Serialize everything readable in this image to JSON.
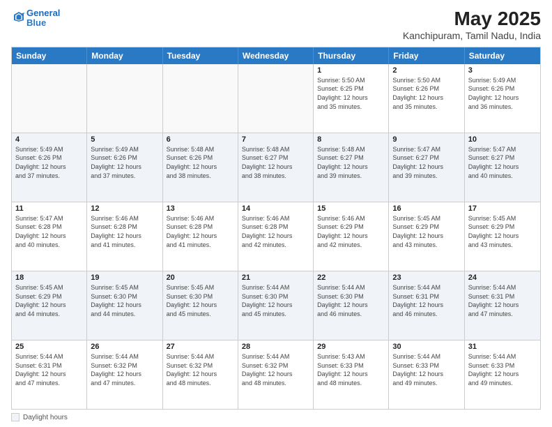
{
  "header": {
    "logo_line1": "General",
    "logo_line2": "Blue",
    "title": "May 2025",
    "subtitle": "Kanchipuram, Tamil Nadu, India"
  },
  "calendar": {
    "days_of_week": [
      "Sunday",
      "Monday",
      "Tuesday",
      "Wednesday",
      "Thursday",
      "Friday",
      "Saturday"
    ],
    "rows": [
      [
        {
          "day": "",
          "info": "",
          "empty": true
        },
        {
          "day": "",
          "info": "",
          "empty": true
        },
        {
          "day": "",
          "info": "",
          "empty": true
        },
        {
          "day": "",
          "info": "",
          "empty": true
        },
        {
          "day": "1",
          "info": "Sunrise: 5:50 AM\nSunset: 6:25 PM\nDaylight: 12 hours\nand 35 minutes."
        },
        {
          "day": "2",
          "info": "Sunrise: 5:50 AM\nSunset: 6:26 PM\nDaylight: 12 hours\nand 35 minutes."
        },
        {
          "day": "3",
          "info": "Sunrise: 5:49 AM\nSunset: 6:26 PM\nDaylight: 12 hours\nand 36 minutes."
        }
      ],
      [
        {
          "day": "4",
          "info": "Sunrise: 5:49 AM\nSunset: 6:26 PM\nDaylight: 12 hours\nand 37 minutes."
        },
        {
          "day": "5",
          "info": "Sunrise: 5:49 AM\nSunset: 6:26 PM\nDaylight: 12 hours\nand 37 minutes."
        },
        {
          "day": "6",
          "info": "Sunrise: 5:48 AM\nSunset: 6:26 PM\nDaylight: 12 hours\nand 38 minutes."
        },
        {
          "day": "7",
          "info": "Sunrise: 5:48 AM\nSunset: 6:27 PM\nDaylight: 12 hours\nand 38 minutes."
        },
        {
          "day": "8",
          "info": "Sunrise: 5:48 AM\nSunset: 6:27 PM\nDaylight: 12 hours\nand 39 minutes."
        },
        {
          "day": "9",
          "info": "Sunrise: 5:47 AM\nSunset: 6:27 PM\nDaylight: 12 hours\nand 39 minutes."
        },
        {
          "day": "10",
          "info": "Sunrise: 5:47 AM\nSunset: 6:27 PM\nDaylight: 12 hours\nand 40 minutes."
        }
      ],
      [
        {
          "day": "11",
          "info": "Sunrise: 5:47 AM\nSunset: 6:28 PM\nDaylight: 12 hours\nand 40 minutes."
        },
        {
          "day": "12",
          "info": "Sunrise: 5:46 AM\nSunset: 6:28 PM\nDaylight: 12 hours\nand 41 minutes."
        },
        {
          "day": "13",
          "info": "Sunrise: 5:46 AM\nSunset: 6:28 PM\nDaylight: 12 hours\nand 41 minutes."
        },
        {
          "day": "14",
          "info": "Sunrise: 5:46 AM\nSunset: 6:28 PM\nDaylight: 12 hours\nand 42 minutes."
        },
        {
          "day": "15",
          "info": "Sunrise: 5:46 AM\nSunset: 6:29 PM\nDaylight: 12 hours\nand 42 minutes."
        },
        {
          "day": "16",
          "info": "Sunrise: 5:45 AM\nSunset: 6:29 PM\nDaylight: 12 hours\nand 43 minutes."
        },
        {
          "day": "17",
          "info": "Sunrise: 5:45 AM\nSunset: 6:29 PM\nDaylight: 12 hours\nand 43 minutes."
        }
      ],
      [
        {
          "day": "18",
          "info": "Sunrise: 5:45 AM\nSunset: 6:29 PM\nDaylight: 12 hours\nand 44 minutes."
        },
        {
          "day": "19",
          "info": "Sunrise: 5:45 AM\nSunset: 6:30 PM\nDaylight: 12 hours\nand 44 minutes."
        },
        {
          "day": "20",
          "info": "Sunrise: 5:45 AM\nSunset: 6:30 PM\nDaylight: 12 hours\nand 45 minutes."
        },
        {
          "day": "21",
          "info": "Sunrise: 5:44 AM\nSunset: 6:30 PM\nDaylight: 12 hours\nand 45 minutes."
        },
        {
          "day": "22",
          "info": "Sunrise: 5:44 AM\nSunset: 6:30 PM\nDaylight: 12 hours\nand 46 minutes."
        },
        {
          "day": "23",
          "info": "Sunrise: 5:44 AM\nSunset: 6:31 PM\nDaylight: 12 hours\nand 46 minutes."
        },
        {
          "day": "24",
          "info": "Sunrise: 5:44 AM\nSunset: 6:31 PM\nDaylight: 12 hours\nand 47 minutes."
        }
      ],
      [
        {
          "day": "25",
          "info": "Sunrise: 5:44 AM\nSunset: 6:31 PM\nDaylight: 12 hours\nand 47 minutes."
        },
        {
          "day": "26",
          "info": "Sunrise: 5:44 AM\nSunset: 6:32 PM\nDaylight: 12 hours\nand 47 minutes."
        },
        {
          "day": "27",
          "info": "Sunrise: 5:44 AM\nSunset: 6:32 PM\nDaylight: 12 hours\nand 48 minutes."
        },
        {
          "day": "28",
          "info": "Sunrise: 5:44 AM\nSunset: 6:32 PM\nDaylight: 12 hours\nand 48 minutes."
        },
        {
          "day": "29",
          "info": "Sunrise: 5:43 AM\nSunset: 6:33 PM\nDaylight: 12 hours\nand 48 minutes."
        },
        {
          "day": "30",
          "info": "Sunrise: 5:44 AM\nSunset: 6:33 PM\nDaylight: 12 hours\nand 49 minutes."
        },
        {
          "day": "31",
          "info": "Sunrise: 5:44 AM\nSunset: 6:33 PM\nDaylight: 12 hours\nand 49 minutes."
        }
      ]
    ]
  },
  "footer": {
    "legend_label": "Daylight hours"
  }
}
